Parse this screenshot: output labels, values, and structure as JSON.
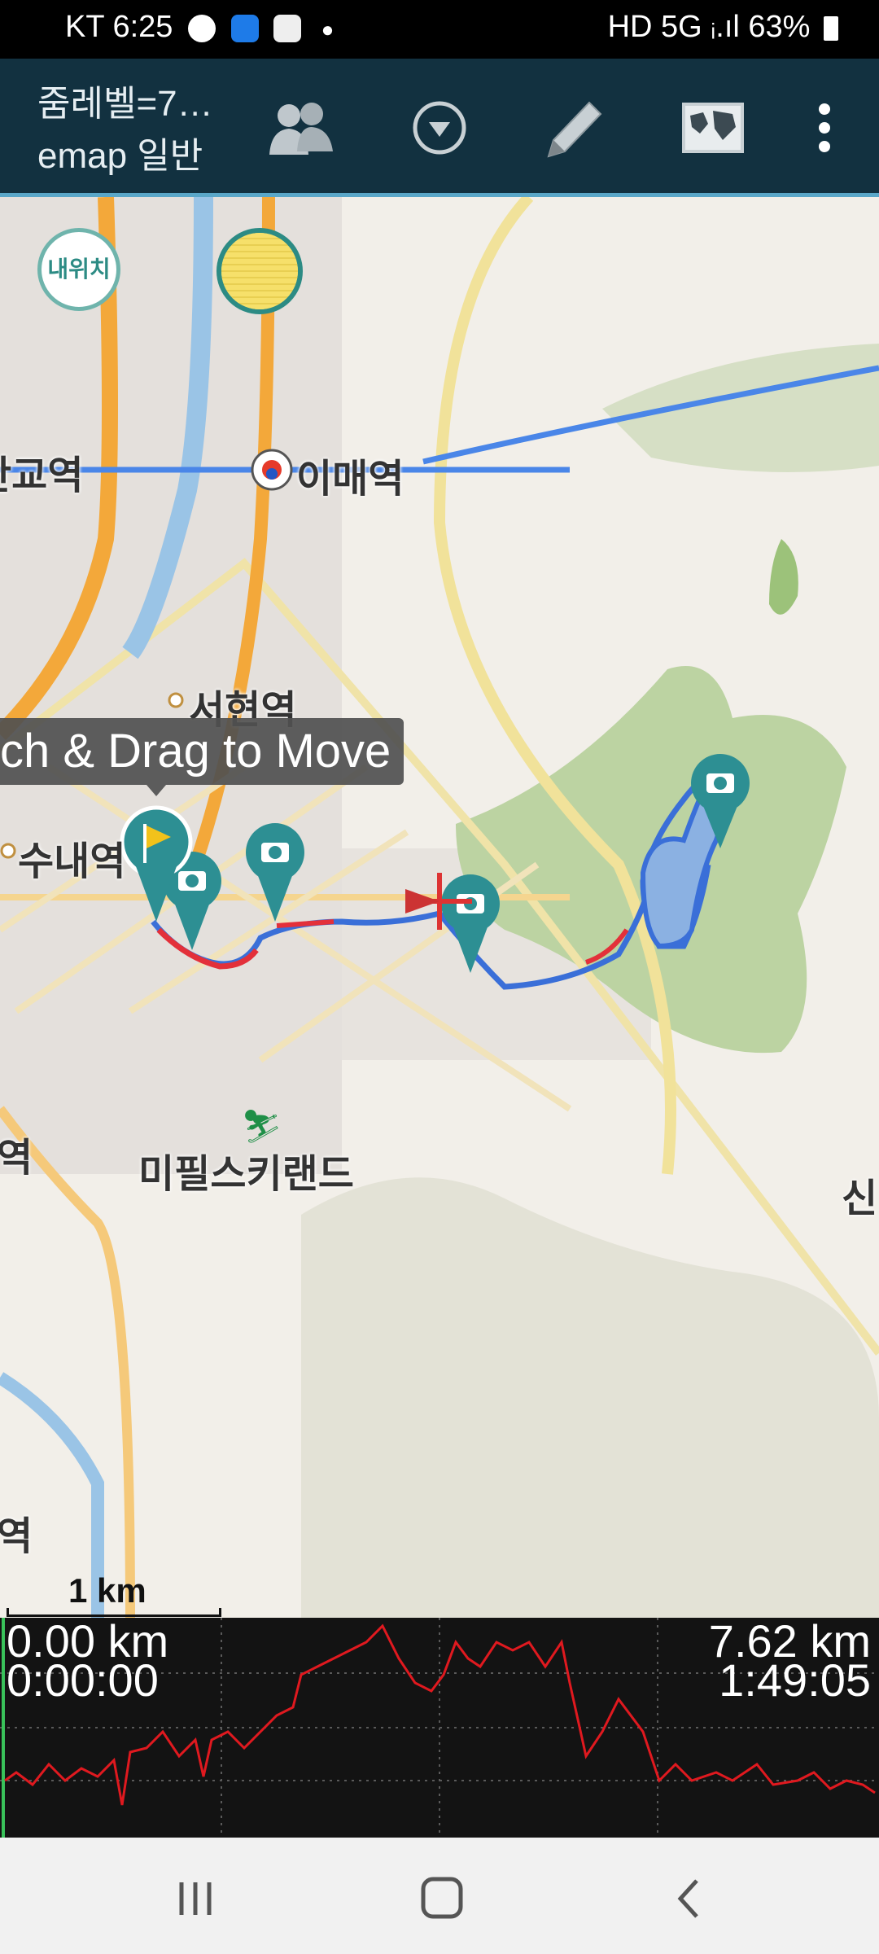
{
  "status_bar": {
    "carrier": "KT",
    "time": "6:25",
    "right": "HD 5G ᵢ.ıl 63%"
  },
  "app_bar": {
    "title_line1": "줌레벨=7…",
    "title_line2": "emap 일반"
  },
  "toolbar": {
    "group_icon": "group-icon",
    "dropdown_icon": "chevron-down-circle-icon",
    "edit_icon": "pencil-icon",
    "map_icon": "world-map-icon",
    "more_icon": "more-vertical-icon"
  },
  "map": {
    "my_location_label": "내위치",
    "tooltip": "ch & Drag to Move",
    "places": {
      "pangyo": "판교역",
      "imae": "이매역",
      "seohyeon": "서현역",
      "sunae": "수내역",
      "mipils": "미필스키랜드",
      "yeok": "역",
      "yeok2": "역",
      "sin": "신"
    },
    "scale_label": "1 km"
  },
  "elevation": {
    "start_distance": "0.00 km",
    "start_time": "0:00:00",
    "end_distance": "7.62 km",
    "end_time": "1:49:05"
  },
  "colors": {
    "app_bar": "#123140",
    "accent": "#5aa7c8",
    "track": "#3a6fd8",
    "track_alt": "#e3303a",
    "marker": "#2d8f93"
  }
}
